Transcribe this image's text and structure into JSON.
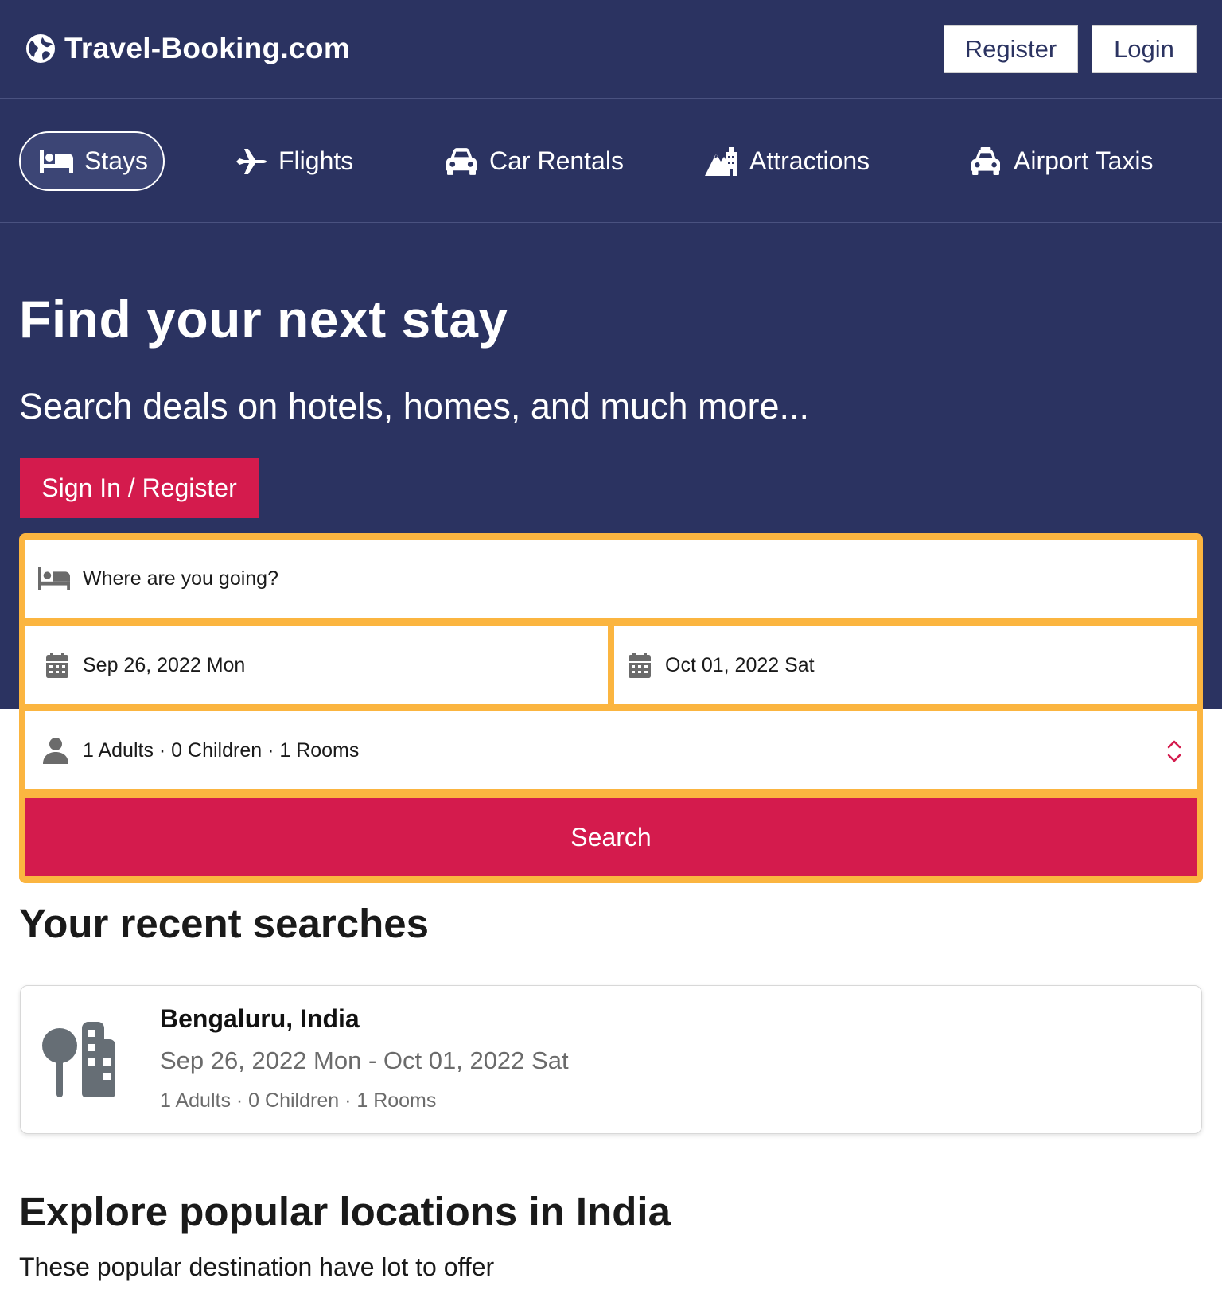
{
  "brand": {
    "name": "Travel-Booking.com",
    "icon": "globe-icon"
  },
  "auth": {
    "register_label": "Register",
    "login_label": "Login"
  },
  "nav": {
    "items": [
      {
        "label": "Stays",
        "icon": "bed-icon",
        "active": true
      },
      {
        "label": "Flights",
        "icon": "plane-icon",
        "active": false
      },
      {
        "label": "Car Rentals",
        "icon": "car-icon",
        "active": false
      },
      {
        "label": "Attractions",
        "icon": "attractions-icon",
        "active": false
      },
      {
        "label": "Airport Taxis",
        "icon": "taxi-icon",
        "active": false
      }
    ]
  },
  "hero": {
    "title": "Find your next stay",
    "subtitle": "Search deals on hotels, homes, and much more...",
    "signin_label": "Sign In / Register"
  },
  "search": {
    "destination_placeholder": "Where are you going?",
    "checkin": "Sep 26, 2022 Mon",
    "checkout": "Oct 01, 2022 Sat",
    "guests": "1 Adults · 0 Children · 1 Rooms",
    "button_label": "Search"
  },
  "recent": {
    "title": "Your recent searches",
    "items": [
      {
        "city": "Bengaluru, India",
        "dates": "Sep 26, 2022 Mon - Oct 01, 2022 Sat",
        "guests": "1 Adults · 0 Children · 1 Rooms",
        "icon": "city-icon"
      }
    ]
  },
  "explore": {
    "title": "Explore popular locations in India",
    "subtitle": "These popular destination have lot to offer"
  },
  "colors": {
    "header_bg": "#2b3361",
    "accent": "#d41b4d",
    "search_border": "#fbb540"
  }
}
